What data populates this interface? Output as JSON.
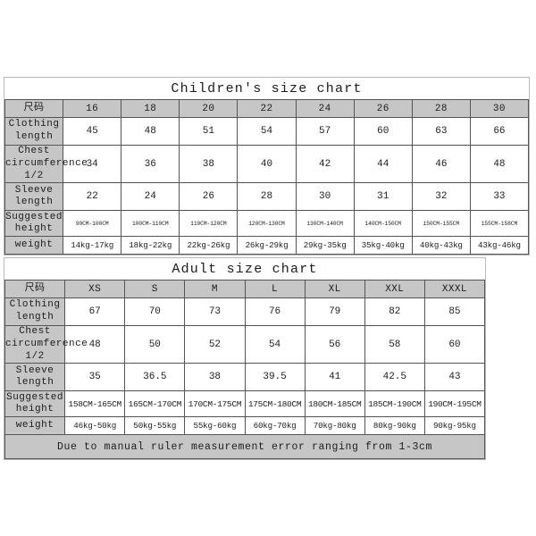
{
  "children_chart": {
    "title": "Children's size chart",
    "size_header_label": "尺码",
    "sizes": [
      "16",
      "18",
      "20",
      "22",
      "24",
      "26",
      "28",
      "30"
    ],
    "rows": [
      {
        "label": "Clothing length",
        "values": [
          "45",
          "48",
          "51",
          "54",
          "57",
          "60",
          "63",
          "66"
        ]
      },
      {
        "label": "Chest circumference 1/2",
        "values": [
          "34",
          "36",
          "38",
          "40",
          "42",
          "44",
          "46",
          "48"
        ]
      },
      {
        "label": "Sleeve length",
        "values": [
          "22",
          "24",
          "26",
          "28",
          "30",
          "31",
          "32",
          "33"
        ]
      },
      {
        "label": "Suggested height",
        "values": [
          "90CM-100CM",
          "100CM-110CM",
          "110CM-120CM",
          "120CM-130CM",
          "130CM-140CM",
          "140CM-150CM",
          "150CM-155CM",
          "155CM-158CM"
        ]
      },
      {
        "label": "weight",
        "values": [
          "14kg-17kg",
          "18kg-22kg",
          "22kg-26kg",
          "26kg-29kg",
          "29kg-35kg",
          "35kg-40kg",
          "40kg-43kg",
          "43kg-46kg"
        ]
      }
    ]
  },
  "adult_chart": {
    "title": "Adult size chart",
    "size_header_label": "尺码",
    "sizes": [
      "XS",
      "S",
      "M",
      "L",
      "XL",
      "XXL",
      "XXXL"
    ],
    "rows": [
      {
        "label": "Clothing length",
        "values": [
          "67",
          "70",
          "73",
          "76",
          "79",
          "82",
          "85"
        ]
      },
      {
        "label": "Chest circumference 1/2",
        "values": [
          "48",
          "50",
          "52",
          "54",
          "56",
          "58",
          "60"
        ]
      },
      {
        "label": "Sleeve length",
        "values": [
          "35",
          "36.5",
          "38",
          "39.5",
          "41",
          "42.5",
          "43"
        ]
      },
      {
        "label": "Suggested height",
        "values": [
          "158CM-165CM",
          "165CM-170CM",
          "170CM-175CM",
          "175CM-180CM",
          "180CM-185CM",
          "185CM-190CM",
          "190CM-195CM"
        ]
      },
      {
        "label": "weight",
        "values": [
          "46kg-50kg",
          "50kg-55kg",
          "55kg-60kg",
          "60kg-70kg",
          "70kg-80kg",
          "80kg-90kg",
          "90kg-95kg"
        ]
      }
    ],
    "footer_note": "Due to manual ruler measurement error ranging from 1-3cm"
  },
  "colors": {
    "header_gray": "#c6c6c6",
    "cell_white": "#ffffff",
    "grid_line": "#555555",
    "page_background": "#ffffff"
  }
}
